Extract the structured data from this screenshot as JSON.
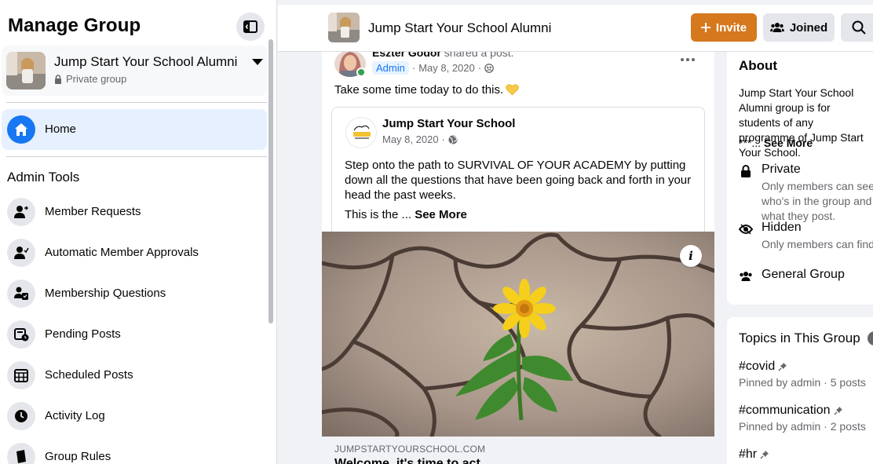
{
  "sidebar": {
    "title": "Manage Group",
    "group": {
      "name": "Jump Start Your School Alumni",
      "privacy": "Private group"
    },
    "home_label": "Home",
    "admin_tools_heading": "Admin Tools",
    "items": [
      {
        "label": "Member Requests",
        "icon": "member-requests-icon"
      },
      {
        "label": "Automatic Member Approvals",
        "icon": "auto-approval-icon"
      },
      {
        "label": "Membership Questions",
        "icon": "membership-questions-icon"
      },
      {
        "label": "Pending Posts",
        "icon": "pending-posts-icon"
      },
      {
        "label": "Scheduled Posts",
        "icon": "calendar-icon"
      },
      {
        "label": "Activity Log",
        "icon": "clock-icon"
      },
      {
        "label": "Group Rules",
        "icon": "rules-icon"
      }
    ]
  },
  "header": {
    "group_title": "Jump Start Your School Alumni",
    "invite_label": "Invite",
    "joined_label": "Joined"
  },
  "post": {
    "author": "Eszter Godor",
    "action": "shared a post.",
    "badge": "Admin",
    "date": "May 8, 2020",
    "text": "Take some time today to do this.",
    "shared": {
      "name": "Jump Start Your School",
      "date": "May 8, 2020",
      "text": "Step onto the path to SURVIVAL OF YOUR ACADEMY by putting down all the questions that have been going back and forth in your head the past weeks.",
      "more_prefix": "This is the ...",
      "see_more": "See More"
    },
    "link": {
      "domain": "JUMPSTARTYOURSCHOOL.COM",
      "title": "Welcome, it's time to act"
    }
  },
  "about": {
    "heading": "About",
    "description": "Jump Start Your School Alumni group is for students of any programme of Jump Start Your School.",
    "more_prefix": "***...",
    "see_more": "See More",
    "private_title": "Private",
    "private_sub": "Only members can see who's in the group and what they post.",
    "hidden_title": "Hidden",
    "hidden_sub": "Only members can find this group.",
    "general": "General Group"
  },
  "topics": {
    "heading": "Topics in This Group",
    "items": [
      {
        "name": "#covid",
        "meta": "Pinned by admin · 5 posts"
      },
      {
        "name": "#communication",
        "meta": "Pinned by admin · 2 posts"
      },
      {
        "name": "#hr",
        "meta": ""
      }
    ]
  },
  "colors": {
    "brand_blue": "#1877f2",
    "invite_orange": "#d6781d",
    "online_green": "#31a24c"
  }
}
